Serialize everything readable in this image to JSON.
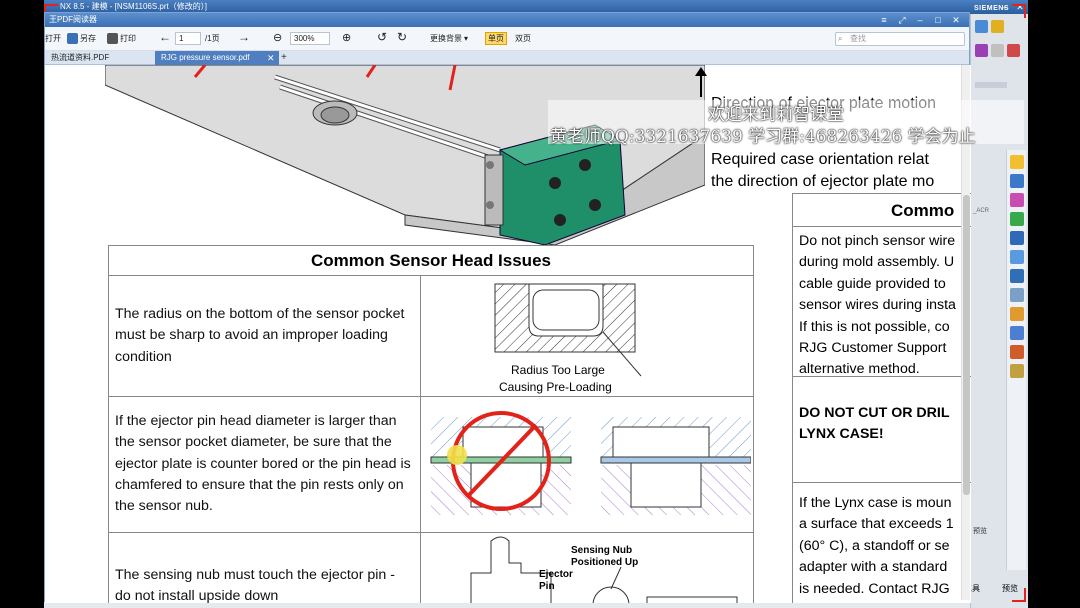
{
  "nx": {
    "title": "NX 8.5 - 建模 - [NSM1106S.prt（修改的）]",
    "brand": "SIEMENS",
    "right_panel_label": "_ACR",
    "bottom_tool_label": "工具",
    "bottom_preview_label": "预览",
    "preview_label": "预览"
  },
  "pdf": {
    "title": "王PDF阅读器",
    "toolbar": {
      "open": "打开",
      "save_as": "另存",
      "print": "打印",
      "page_current": "1",
      "page_total": "/1页",
      "zoom": "300%",
      "background": "更换背景",
      "single_page": "单页",
      "double_page": "双页",
      "search_placeholder": "查找"
    },
    "tabs": [
      {
        "label": "热流道资料.PDF"
      },
      {
        "label": "RJG pressure sensor.pdf"
      }
    ],
    "add_tab": "+"
  },
  "doc": {
    "right_top": {
      "line1": "Direction of ejector plate motion",
      "line2": "Required case orientation relat",
      "line3": "the direction of ejector plate mo"
    },
    "table_title": "Common Sensor Head Issues",
    "rows": [
      {
        "text": "The radius on the bottom of the sensor pocket must be sharp to avoid an improper loading condition",
        "caption1": "Radius Too Large",
        "caption2": "Causing Pre-Loading"
      },
      {
        "text": "If the ejector pin head diameter is larger than the sensor pocket diameter, be sure that the ejector plate is counter bored or the pin head is chamfered to ensure that the pin rests only on the sensor nub."
      },
      {
        "text": "The sensing nub must touch the ejector pin - do not install upside down",
        "caption1": "Sensing Nub",
        "caption2": "Positioned Up",
        "caption3": "Ejector",
        "caption4": "Pin"
      }
    ],
    "side_title": "Commo",
    "side_cells": [
      {
        "lines": [
          "Do not pinch sensor wire",
          "during mold assembly.  U",
          "cable guide provided to",
          "sensor wires during insta",
          "If this is not possible, co",
          "RJG Customer Support",
          "alternative method."
        ]
      },
      {
        "lines": [
          "DO NOT CUT OR DRIL",
          "LYNX CASE!"
        ]
      },
      {
        "lines": [
          "If the Lynx case is moun",
          "a surface that exceeds 1",
          "(60° C), a standoff or se",
          "adapter with a standard",
          "is needed.  Contact RJG"
        ]
      }
    ]
  },
  "overlay": {
    "line1": "欢迎来到莉智课堂",
    "line2": "黄老师QQ:3321637639 学习群:468263426 学会为止"
  },
  "colors": {
    "sensor_green": "#1f8f6a",
    "accent_red": "#e2231a",
    "title_blue": "#3d70b3"
  }
}
